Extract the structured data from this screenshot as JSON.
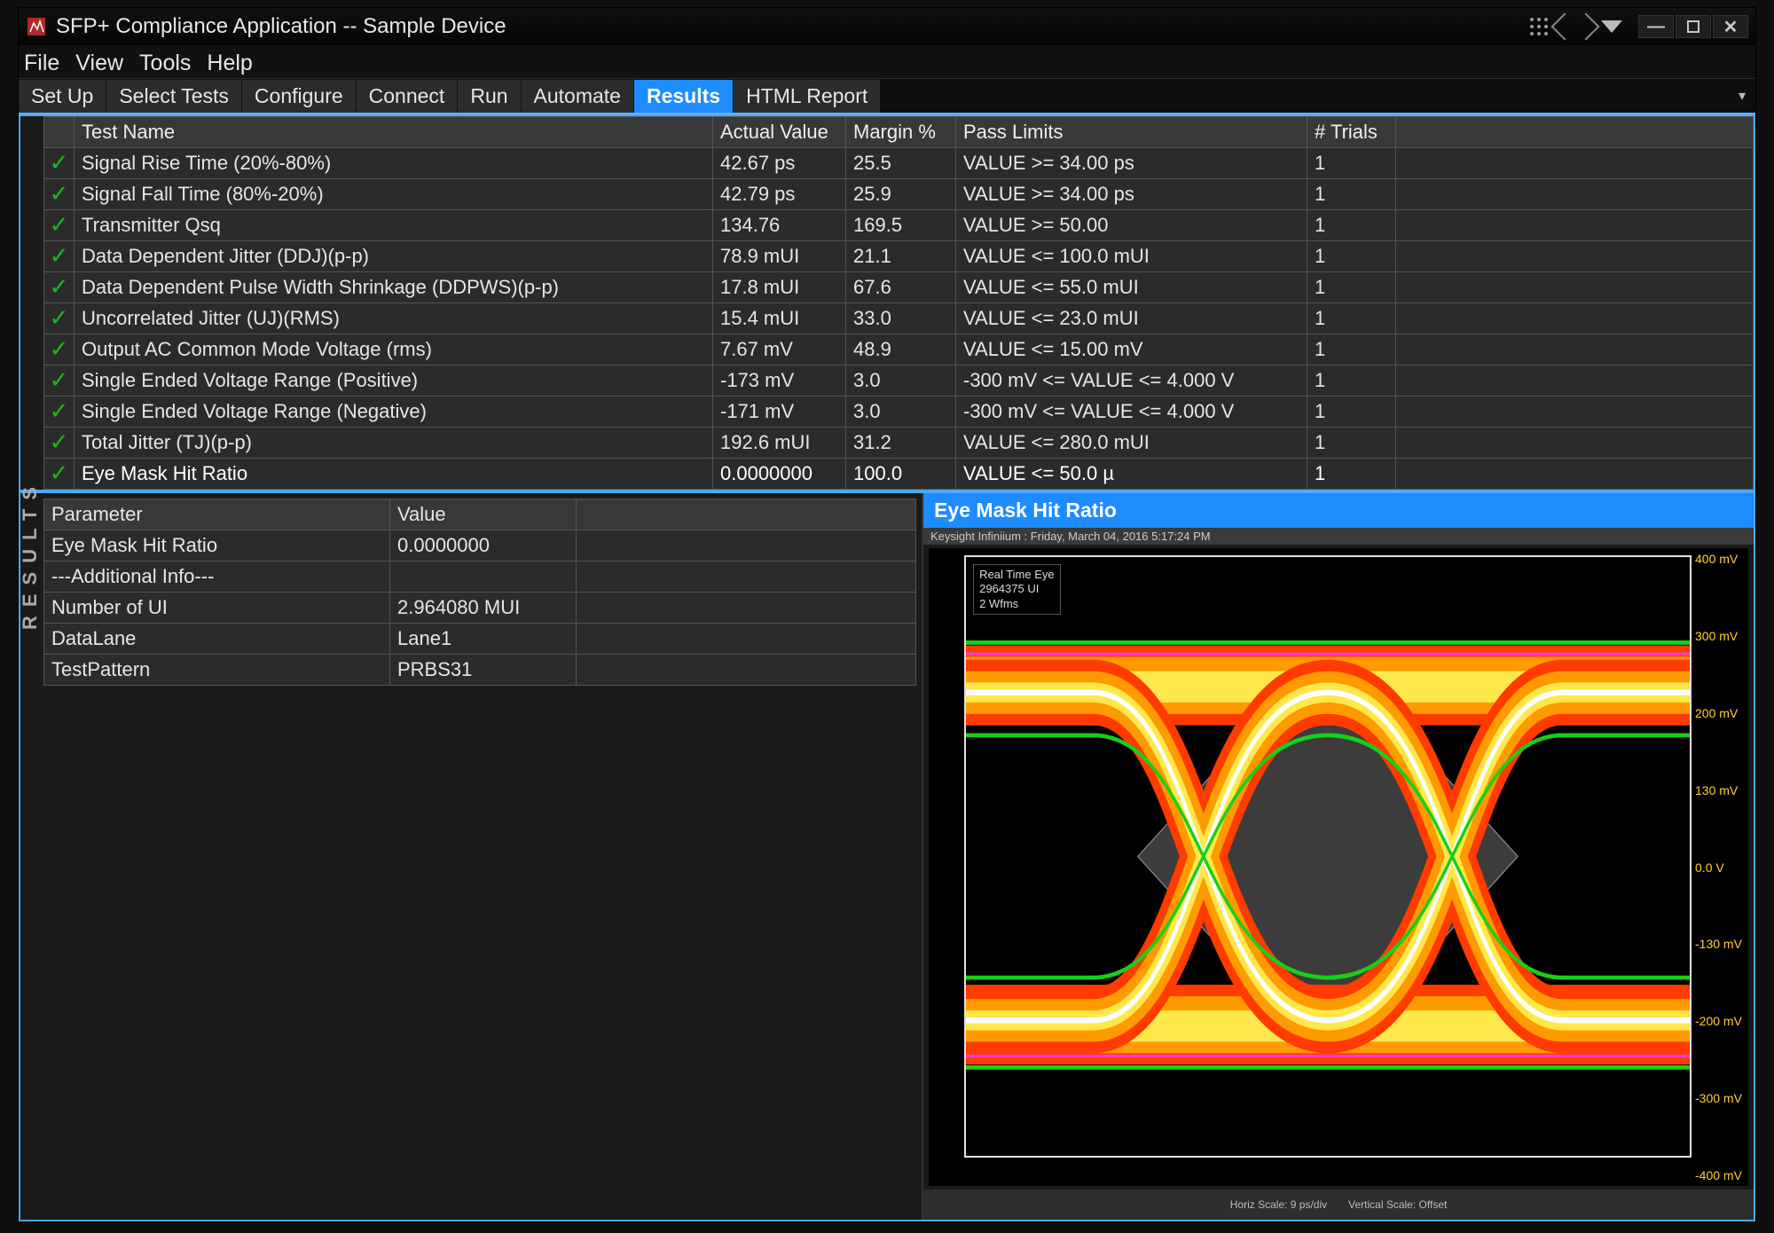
{
  "window": {
    "title": "SFP+ Compliance Application -- Sample Device"
  },
  "menu": {
    "items": [
      "File",
      "View",
      "Tools",
      "Help"
    ]
  },
  "tabs": {
    "items": [
      "Set Up",
      "Select Tests",
      "Configure",
      "Connect",
      "Run",
      "Automate",
      "Results",
      "HTML Report"
    ],
    "active": "Results"
  },
  "results_sidebar_label": "RESULTS",
  "results_table": {
    "headers": [
      "",
      "Test Name",
      "Actual Value",
      "Margin %",
      "Pass Limits",
      "# Trials",
      ""
    ],
    "rows": [
      {
        "pass": true,
        "name": "Signal Rise Time (20%-80%)",
        "actual": "42.67 ps",
        "margin": "25.5",
        "limits": "VALUE >= 34.00 ps",
        "trials": "1",
        "selected": false
      },
      {
        "pass": true,
        "name": "Signal Fall Time (80%-20%)",
        "actual": "42.79 ps",
        "margin": "25.9",
        "limits": "VALUE >= 34.00 ps",
        "trials": "1",
        "selected": false
      },
      {
        "pass": true,
        "name": "Transmitter Qsq",
        "actual": "134.76",
        "margin": "169.5",
        "limits": "VALUE >= 50.00",
        "trials": "1",
        "selected": false
      },
      {
        "pass": true,
        "name": "Data Dependent Jitter (DDJ)(p-p)",
        "actual": "78.9 mUI",
        "margin": "21.1",
        "limits": "VALUE <= 100.0 mUI",
        "trials": "1",
        "selected": false
      },
      {
        "pass": true,
        "name": "Data Dependent Pulse Width Shrinkage (DDPWS)(p-p)",
        "actual": "17.8 mUI",
        "margin": "67.6",
        "limits": "VALUE <= 55.0 mUI",
        "trials": "1",
        "selected": false
      },
      {
        "pass": true,
        "name": "Uncorrelated Jitter (UJ)(RMS)",
        "actual": "15.4 mUI",
        "margin": "33.0",
        "limits": "VALUE <= 23.0 mUI",
        "trials": "1",
        "selected": false
      },
      {
        "pass": true,
        "name": "Output AC Common Mode Voltage (rms)",
        "actual": "7.67 mV",
        "margin": "48.9",
        "limits": "VALUE <= 15.00 mV",
        "trials": "1",
        "selected": false
      },
      {
        "pass": true,
        "name": "Single Ended Voltage Range (Positive)",
        "actual": "-173 mV",
        "margin": "3.0",
        "limits": "-300 mV <= VALUE <= 4.000 V",
        "trials": "1",
        "selected": false
      },
      {
        "pass": true,
        "name": "Single Ended Voltage Range (Negative)",
        "actual": "-171 mV",
        "margin": "3.0",
        "limits": "-300 mV <= VALUE <= 4.000 V",
        "trials": "1",
        "selected": false
      },
      {
        "pass": true,
        "name": "Total Jitter (TJ)(p-p)",
        "actual": "192.6 mUI",
        "margin": "31.2",
        "limits": "VALUE <= 280.0 mUI",
        "trials": "1",
        "selected": false
      },
      {
        "pass": true,
        "name": "Eye Mask Hit Ratio",
        "actual": "0.0000000",
        "margin": "100.0",
        "limits": "VALUE <= 50.0 µ",
        "trials": "1",
        "selected": true
      }
    ]
  },
  "params_table": {
    "headers": [
      "Parameter",
      "Value",
      ""
    ],
    "rows": [
      {
        "name": "Eye Mask Hit Ratio",
        "value": "0.0000000"
      },
      {
        "name": "---Additional Info---",
        "value": ""
      },
      {
        "name": "Number of UI",
        "value": "2.964080 MUI"
      },
      {
        "name": "DataLane",
        "value": "Lane1"
      },
      {
        "name": "TestPattern",
        "value": "PRBS31"
      }
    ]
  },
  "eye_panel": {
    "title": "Eye Mask Hit Ratio",
    "meta": "Keysight Infiniium : Friday, March 04, 2016 5:17:24 PM",
    "legend_lines": [
      "Real Time Eye",
      "2964375 UI",
      "2 Wfms"
    ],
    "y_ticks": [
      "400 mV",
      "300 mV",
      "200 mV",
      "130 mV",
      "0.0 V",
      "-130 mV",
      "-200 mV",
      "-300 mV",
      "-400 mV"
    ],
    "footer_left": "Horiz Scale: 9 ps/div",
    "footer_right": "Vertical Scale: Offset"
  }
}
